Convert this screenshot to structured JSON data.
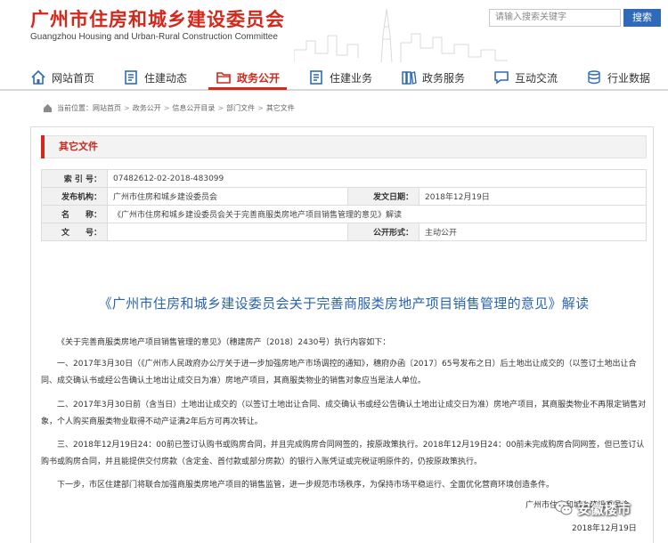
{
  "header": {
    "title": "广州市住房和城乡建设委员会",
    "subtitle": "Guangzhou Housing and Urban-Rural Construction Committee",
    "search_placeholder": "请输入搜索关键字",
    "search_button": "搜索"
  },
  "nav": {
    "items": [
      {
        "label": "网站首页",
        "icon": "house-icon"
      },
      {
        "label": "住建动态",
        "icon": "document-icon"
      },
      {
        "label": "政务公开",
        "icon": "folder-icon",
        "active": true
      },
      {
        "label": "住建业务",
        "icon": "document-icon"
      },
      {
        "label": "政务服务",
        "icon": "books-icon"
      },
      {
        "label": "互动交流",
        "icon": "chat-icon"
      },
      {
        "label": "行业数据",
        "icon": "coins-icon"
      }
    ],
    "accent": "#d4281c"
  },
  "breadcrumb": {
    "prefix": "当前位置：",
    "items": [
      "网站首页",
      "政务公开",
      "信息公开目录",
      "部门文件",
      "其它文件"
    ]
  },
  "section": {
    "title": "其它文件"
  },
  "meta": {
    "index_label": "索 引 号：",
    "index_value": "07482612-02-2018-483099",
    "publisher_label": "发布机构：",
    "publisher_value": "广州市住房和城乡建设委员会",
    "date_label": "发文日期：",
    "date_value": "2018年12月19日",
    "name_label": "名　　称：",
    "name_value": "《广州市住房和城乡建设委员会关于完善商服类房地产项目销售管理的意见》解读",
    "docno_label": "文　　号：",
    "docno_value": "",
    "form_label": "公开形式：",
    "form_value": "主动公开"
  },
  "article": {
    "title": "《广州市住房和城乡建设委员会关于完善商服类房地产项目销售管理的意见》解读",
    "paragraphs": [
      "《关于完善商服类房地产项目销售管理的意见》（穗建房产〔2018〕2430号）执行内容如下：",
      "一、2017年3月30日（《广州市人民政府办公厅关于进一步加强房地产市场调控的通知》，穗府办函〔2017〕65号发布之日）后土地出让成交的（以签订土地出让合同、成交确认书或经公告确认土地出让成交日为准）房地产项目，其商服类物业的销售对象应当是法人单位。",
      "二、2017年3月30日前（含当日）土地出让成交的（以签订土地出让合同、成交确认书或经公告确认土地出让成交日为准）房地产项目，其商服类物业不再限定销售对象，个人购买商服类物业取得不动产证满2年后方可再次转让。",
      "三、2018年12月19日24：00前已签订认购书或购房合同，并且完成购房合同网签的，按原政策执行。2018年12月19日24：00前未完成购房合同网签，但已签订认购书或购房合同，并且能提供交付房款（含定金、首付款或部分房款）的银行入账凭证或完税证明原件的，仍按原政策执行。",
      "下一步，市区住建部门将联合加强商服类房地产项目的销售监管，进一步规范市场秩序，为保持市场平稳运行、全面优化营商环境创造条件。"
    ],
    "signer": "广州市住房和城乡建设委员会",
    "sign_date": "2018年12月19日"
  },
  "watermark": {
    "text": "安徽楼市"
  }
}
